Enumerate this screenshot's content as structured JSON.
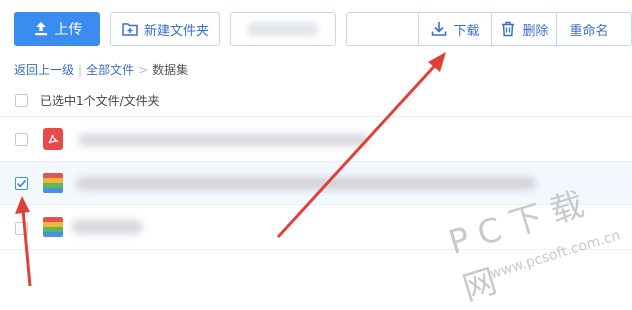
{
  "toolbar": {
    "upload_label": "上传",
    "new_folder_label": "新建文件夹",
    "download_label": "下载",
    "delete_label": "删除",
    "rename_label": "重命名"
  },
  "breadcrumb": {
    "back": "返回上一级",
    "separator": "|",
    "all_files": "全部文件",
    "arrow": ">",
    "current": "数据集"
  },
  "selection": {
    "status": "已选中1个文件/文件夹"
  },
  "files": [
    {
      "type": "pdf-icon",
      "selected": false
    },
    {
      "type": "archive-icon",
      "selected": true
    },
    {
      "type": "archive-icon",
      "selected": false
    }
  ],
  "watermark": {
    "brand": "PC下载网",
    "url": "www.pcsoft.com.cn"
  },
  "colors": {
    "accent": "#3b8cf0",
    "link": "#3a6fc4",
    "annotation_arrow": "#e0403a",
    "pdf_red": "#e8494a"
  }
}
